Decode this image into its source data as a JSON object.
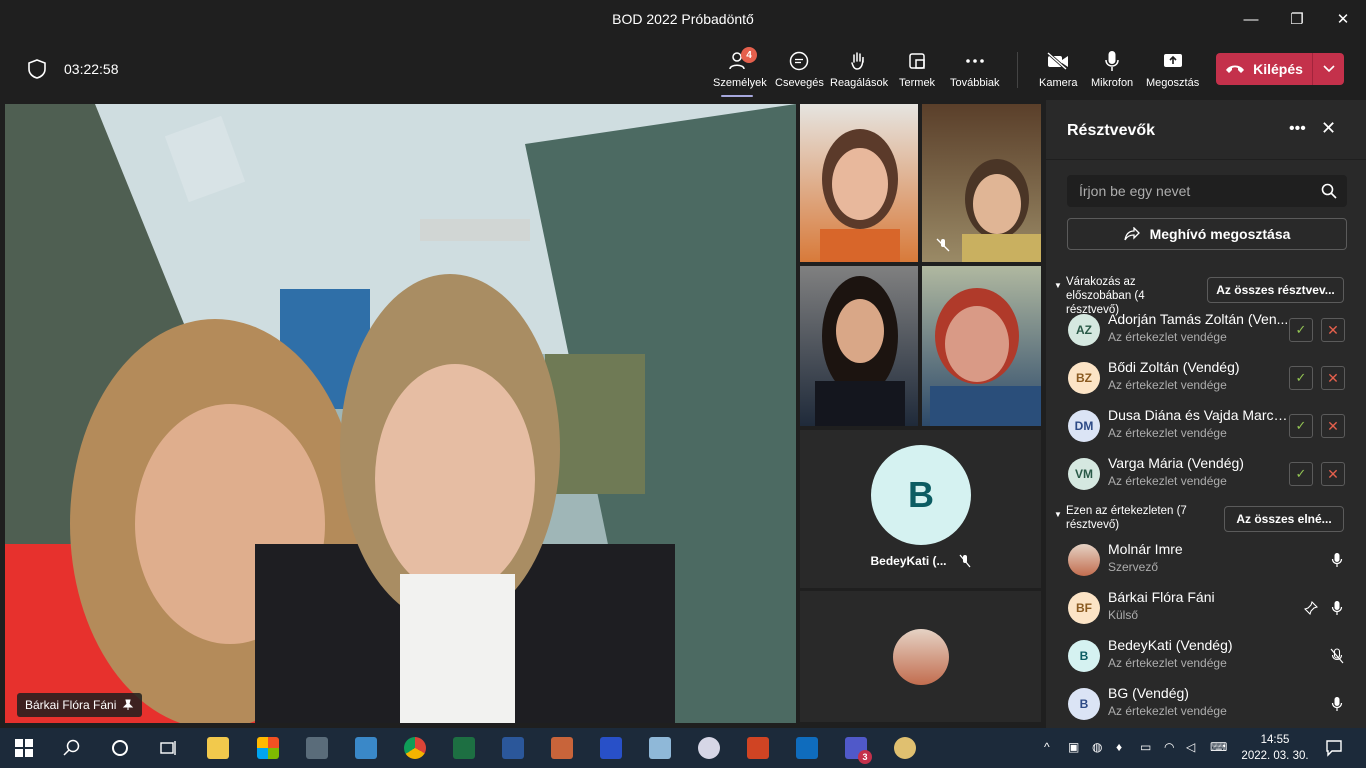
{
  "window": {
    "title": "BOD 2022 Próbadöntő",
    "minimize": "—",
    "maximize": "❐",
    "close": "✕"
  },
  "toolbar": {
    "timer": "03:22:58",
    "people_label": "Személyek",
    "people_badge": "4",
    "chat_label": "Csevegés",
    "reactions_label": "Reagálások",
    "rooms_label": "Termek",
    "more_label": "Továbbiak",
    "camera_label": "Kamera",
    "mic_label": "Mikrofon",
    "share_label": "Megosztás",
    "leave_label": "Kilépés"
  },
  "stage": {
    "main_name": "Bárkai Flóra Fáni",
    "bedey_initial": "B",
    "bedey_name": "BedeyKati (..."
  },
  "panel": {
    "title": "Résztvevők",
    "search_placeholder": "Írjon be egy nevet",
    "invite_label": "Meghívó megosztása",
    "lobby_title": "Várakozás az előszobában (4 résztvevő)",
    "lobby_btn": "Az összes résztvev...",
    "lobby": [
      {
        "initials": "AZ",
        "name": "Adorján Tamás Zoltán (Ven...",
        "sub": "Az értekezlet vendége"
      },
      {
        "initials": "BZ",
        "name": "Bődi Zoltán (Vendég)",
        "sub": "Az értekezlet vendége"
      },
      {
        "initials": "DM",
        "name": "Dusa Diána és Vajda Marcel...",
        "sub": "Az értekezlet vendége"
      },
      {
        "initials": "VM",
        "name": "Varga Mária (Vendég)",
        "sub": "Az értekezlet vendége"
      }
    ],
    "in_meeting_title": "Ezen az értekezleten (7 résztvevő)",
    "in_meeting_btn": "Az összes elné...",
    "in_meeting": [
      {
        "initials": "",
        "name": "Molnár Imre",
        "sub": "Szervező"
      },
      {
        "initials": "BF",
        "name": "Bárkai Flóra Fáni",
        "sub": "Külső"
      },
      {
        "initials": "B",
        "name": "BedeyKati (Vendég)",
        "sub": "Az értekezlet vendége"
      },
      {
        "initials": "B",
        "name": "BG (Vendég)",
        "sub": "Az értekezlet vendége"
      }
    ]
  },
  "taskbar": {
    "time": "14:55",
    "date": "2022. 03. 30.",
    "teams_badge": "3"
  },
  "colors": {
    "accent": "#a6a7dc",
    "leave": "#c4314b",
    "ok": "#92c353",
    "reject": "#e5604d"
  }
}
